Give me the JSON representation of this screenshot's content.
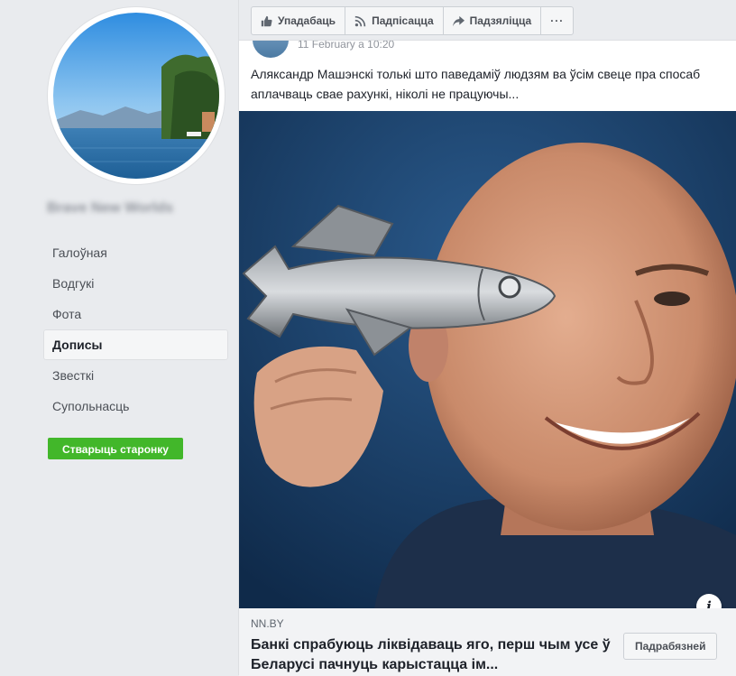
{
  "sidebar": {
    "page_name": "Brave New Worlds",
    "nav": [
      {
        "label": "Галоўная"
      },
      {
        "label": "Водгукі"
      },
      {
        "label": "Фота"
      },
      {
        "label": "Дописы"
      },
      {
        "label": "Звесткі"
      },
      {
        "label": "Супольнасць"
      }
    ],
    "create_page_label": "Стварыць старонку"
  },
  "actionbar": {
    "like_label": "Упадабаць",
    "subscribe_label": "Падпісацца",
    "share_label": "Падзяліцца",
    "more_label": "···"
  },
  "post": {
    "timestamp": "11 February a 10:20",
    "text": "Аляксандр Машэнскі толькі што паведаміў людзям ва ўсім свеце пра спосаб аплачваць свае рахункі, ніколі не працуючы...",
    "link": {
      "domain": "NN.BY",
      "title": "Банкі спрабуюць ліквідаваць яго, перш чым усе ў Беларусі пачнуць карыстацца ім...",
      "button_label": "Падрабязней"
    }
  },
  "colors": {
    "accent_green": "#42b72a",
    "background": "#e9ebee",
    "image_bg": "#163457"
  },
  "icons": {
    "like": "thumbs-up-icon",
    "subscribe": "rss-icon",
    "share": "share-arrow-icon",
    "info": "info-icon"
  }
}
